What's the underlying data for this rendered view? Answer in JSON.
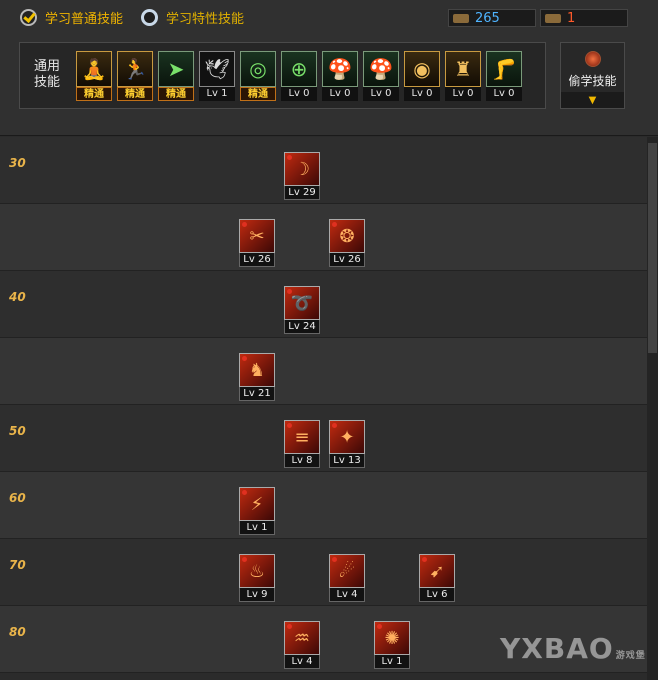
{
  "tabs": [
    {
      "label": "学习普通技能",
      "selected": true
    },
    {
      "label": "学习特性技能",
      "selected": false
    }
  ],
  "sp": {
    "normal": "265",
    "special": "1"
  },
  "common": {
    "label": "通用技能",
    "skills": [
      {
        "icon": "sit-figure-icon",
        "glyph": "🧘",
        "style": "gold",
        "caption": "精通"
      },
      {
        "icon": "runner-icon",
        "glyph": "🏃",
        "style": "gold",
        "caption": "精通"
      },
      {
        "icon": "dash-icon",
        "glyph": "➤",
        "style": "green",
        "caption": "精通"
      },
      {
        "icon": "wings-icon",
        "glyph": "🕊",
        "style": "plain",
        "caption": "Lv 1"
      },
      {
        "icon": "crosshair-icon",
        "glyph": "◎",
        "style": "green",
        "caption": "精通"
      },
      {
        "icon": "target-icon",
        "glyph": "⊕",
        "style": "green",
        "caption": "Lv 0"
      },
      {
        "icon": "mushroom-icon",
        "glyph": "🍄",
        "style": "green",
        "caption": "Lv 0"
      },
      {
        "icon": "mushroom-alt-icon",
        "glyph": "🍄",
        "style": "green",
        "caption": "Lv 0"
      },
      {
        "icon": "eye-icon",
        "glyph": "◉",
        "style": "gold",
        "caption": "Lv 0"
      },
      {
        "icon": "strongman-icon",
        "glyph": "♜",
        "style": "gold",
        "caption": "Lv 0"
      },
      {
        "icon": "kick-icon",
        "glyph": "🦵",
        "style": "green",
        "caption": "Lv 0"
      }
    ]
  },
  "steal": {
    "label": "偷学技能",
    "arrow": "▼"
  },
  "tree": {
    "rows": [
      {
        "level": "30",
        "skills": [
          {
            "col": 1,
            "caption": "Lv 29",
            "glyph": "☽"
          }
        ]
      },
      {
        "level": "",
        "skills": [
          {
            "col": 0,
            "caption": "Lv 26",
            "glyph": "✂"
          },
          {
            "col": 2,
            "caption": "Lv 26",
            "glyph": "❂"
          }
        ]
      },
      {
        "level": "40",
        "skills": [
          {
            "col": 1,
            "caption": "Lv 24",
            "glyph": "➰"
          }
        ]
      },
      {
        "level": "",
        "skills": [
          {
            "col": 0,
            "caption": "Lv 21",
            "glyph": "♞"
          }
        ]
      },
      {
        "level": "50",
        "skills": [
          {
            "col": 1,
            "caption": "Lv 8",
            "glyph": "≡"
          },
          {
            "col": 2,
            "caption": "Lv 13",
            "glyph": "✦"
          }
        ]
      },
      {
        "level": "60",
        "skills": [
          {
            "col": 0,
            "caption": "Lv 1",
            "glyph": "⚡"
          }
        ]
      },
      {
        "level": "70",
        "skills": [
          {
            "col": 0,
            "caption": "Lv 9",
            "glyph": "♨"
          },
          {
            "col": 2,
            "caption": "Lv 4",
            "glyph": "☄"
          },
          {
            "col": 4,
            "caption": "Lv 6",
            "glyph": "➹"
          }
        ]
      },
      {
        "level": "80",
        "skills": [
          {
            "col": 1,
            "caption": "Lv 4",
            "glyph": "♒"
          },
          {
            "col": 3,
            "caption": "Lv 1",
            "glyph": "✺"
          }
        ]
      }
    ]
  },
  "watermark": {
    "text": "YXBAO",
    "sub": "游戏堡"
  }
}
